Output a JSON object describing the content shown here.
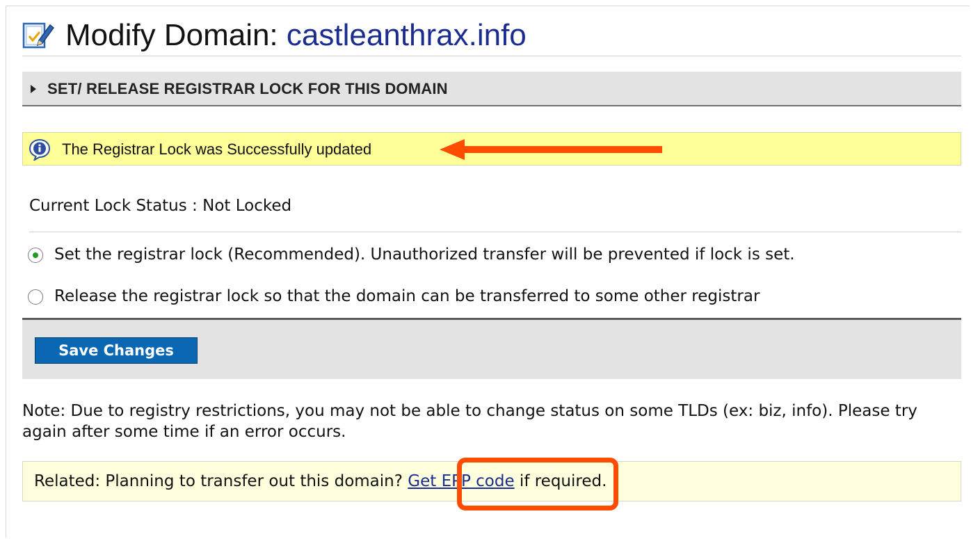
{
  "page": {
    "title_prefix": "Modify Domain: ",
    "domain": "castleanthrax.info"
  },
  "section": {
    "header_label": "SET/ RELEASE REGISTRAR LOCK FOR THIS DOMAIN"
  },
  "notice": {
    "message": "The Registrar Lock was Successfully updated"
  },
  "lock": {
    "status_text": "Current Lock Status : Not Locked",
    "options": [
      {
        "label": "Set the registrar lock (Recommended). Unauthorized transfer will be prevented if lock is set.",
        "checked": true
      },
      {
        "label": "Release the registrar lock so that the domain can be transferred to some other registrar",
        "checked": false
      }
    ]
  },
  "actions": {
    "save_label": "Save Changes"
  },
  "note": {
    "text": "Note: Due to registry restrictions, you may not be able to change status on some TLDs (ex: biz, info). Please try again after some time if an error occurs."
  },
  "related": {
    "prefix": "Related: Planning to transfer out this domain? ",
    "link_text": "Get EPP code",
    "suffix": " if required."
  },
  "colors": {
    "annotation": "#ff4d00",
    "notice_bg": "#ffff99",
    "button_bg": "#0b67b2",
    "link": "#1a2d8f"
  },
  "icons": {
    "title": "edit-document-icon",
    "notice": "info-icon",
    "section": "triangle-right-icon"
  }
}
